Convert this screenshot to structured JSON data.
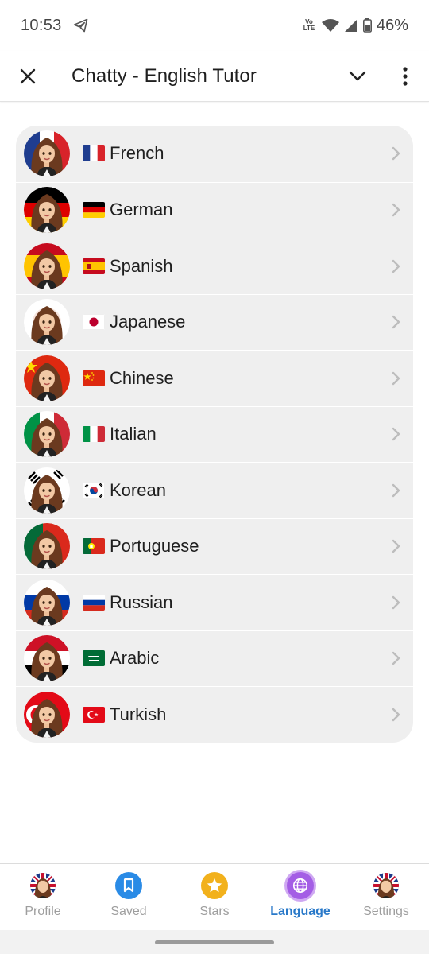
{
  "status_bar": {
    "time": "10:53",
    "network": "Vo LTE",
    "battery": "46%",
    "icons": [
      "telegram-icon",
      "volte-icon",
      "wifi-icon",
      "signal-icon",
      "battery-icon"
    ]
  },
  "app_bar": {
    "title": "Chatty - English Tutor",
    "icons": [
      "close-icon",
      "chevron-down-icon",
      "more-vert-icon"
    ]
  },
  "languages": [
    {
      "name": "French",
      "flag_icon": "flag-france-icon",
      "colors": [
        "#1f3d8f",
        "#ffffff",
        "#d8232a"
      ]
    },
    {
      "name": "German",
      "flag_icon": "flag-germany-icon",
      "colors": [
        "#000000",
        "#dd0000",
        "#ffce00"
      ]
    },
    {
      "name": "Spanish",
      "flag_icon": "flag-spain-icon",
      "colors": [
        "#c60b1e",
        "#ffc400",
        "#c60b1e"
      ]
    },
    {
      "name": "Japanese",
      "flag_icon": "flag-japan-icon",
      "colors": [
        "#ffffff",
        "#bc002d"
      ]
    },
    {
      "name": "Chinese",
      "flag_icon": "flag-china-icon",
      "colors": [
        "#de2910",
        "#ffde00"
      ]
    },
    {
      "name": "Italian",
      "flag_icon": "flag-italy-icon",
      "colors": [
        "#009246",
        "#ffffff",
        "#ce2b37"
      ]
    },
    {
      "name": "Korean",
      "flag_icon": "flag-korea-icon",
      "colors": [
        "#ffffff",
        "#cd2e3a",
        "#0047a0",
        "#000000"
      ]
    },
    {
      "name": "Portuguese",
      "flag_icon": "flag-portugal-icon",
      "colors": [
        "#046a38",
        "#da291c",
        "#ffe900"
      ]
    },
    {
      "name": "Russian",
      "flag_icon": "flag-russia-icon",
      "colors": [
        "#ffffff",
        "#0039a6",
        "#d52b1e"
      ]
    },
    {
      "name": "Arabic",
      "flag_icon": "flag-saudi-arabia-icon",
      "colors": [
        "#006c35",
        "#ffffff"
      ]
    },
    {
      "name": "Turkish",
      "flag_icon": "flag-turkey-icon",
      "colors": [
        "#e30a17",
        "#ffffff"
      ]
    }
  ],
  "bottom_nav": [
    {
      "label": "Profile",
      "icon": "profile-avatar-icon",
      "active": false
    },
    {
      "label": "Saved",
      "icon": "bookmark-icon",
      "active": false
    },
    {
      "label": "Stars",
      "icon": "star-icon",
      "active": false
    },
    {
      "label": "Language",
      "icon": "globe-icon",
      "active": true
    },
    {
      "label": "Settings",
      "icon": "settings-avatar-icon",
      "active": false
    }
  ],
  "colors": {
    "accent": "#2979c9",
    "list_background": "#efefef",
    "inactive_label": "#9e9e9e"
  }
}
